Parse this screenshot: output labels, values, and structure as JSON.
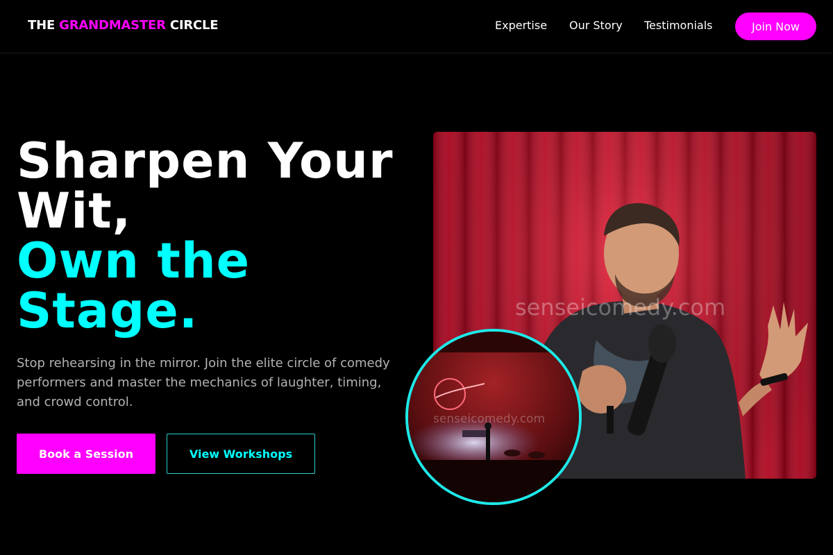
{
  "header": {
    "logo_prefix": "THE",
    "logo_accent": "GRANDMASTER",
    "logo_suffix": "CIRCLE",
    "nav": [
      "Expertise",
      "Our Story",
      "Testimonials"
    ],
    "cta_label": "Join Now"
  },
  "hero": {
    "headline_line1": "Sharpen Your",
    "headline_line2": "Wit,",
    "headline_line3": "Own the",
    "headline_line4": "Stage.",
    "subcopy": "Stop rehearsing in the mirror. Join the elite circle of comedy performers and master the mechanics of laughter, timing, and crowd control.",
    "primary_button": "Book a Session",
    "secondary_button": "View Workshops"
  },
  "media": {
    "main_photo_watermark": "senseicomedy.com",
    "inset_photo_watermark": "senseicomedy.com"
  },
  "colors": {
    "background": "#000000",
    "accent_magenta": "#ff00ff",
    "accent_cyan": "#00ffff",
    "body_text": "#b3b3b3"
  }
}
